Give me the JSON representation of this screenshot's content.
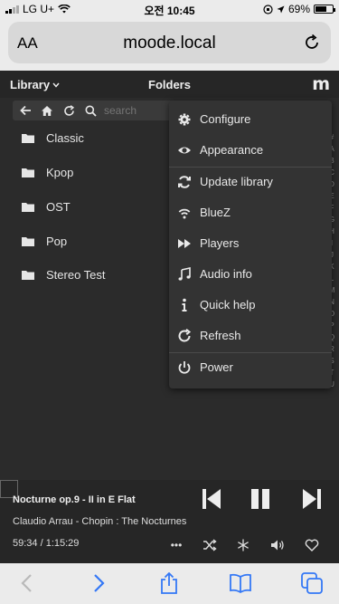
{
  "status_bar": {
    "carrier": "LG U+",
    "time": "오전 10:45",
    "battery": "69%"
  },
  "browser": {
    "aa_label": "AA",
    "url": "moode.local"
  },
  "app_header": {
    "library_label": "Library",
    "title": "Folders",
    "logo": "m"
  },
  "toolbar": {
    "search_placeholder": "search"
  },
  "folders": [
    {
      "label": "Classic"
    },
    {
      "label": "Kpop"
    },
    {
      "label": "OST"
    },
    {
      "label": "Pop"
    },
    {
      "label": "Stereo Test"
    }
  ],
  "alphabet_index": [
    "#",
    "A",
    "B",
    "C",
    "D",
    "E",
    "F",
    "G",
    "H",
    "I",
    "J",
    "K",
    "L",
    "M",
    "N",
    "O",
    "P",
    "Q",
    "R",
    "S",
    "T",
    "U"
  ],
  "menu": {
    "items": [
      {
        "label": "Configure",
        "icon": "gear-icon"
      },
      {
        "label": "Appearance",
        "icon": "eye-icon"
      },
      {
        "label": "Update library",
        "icon": "sync-icon"
      },
      {
        "label": "BlueZ",
        "icon": "wifi-icon"
      },
      {
        "label": "Players",
        "icon": "fast-forward-icon"
      },
      {
        "label": "Audio info",
        "icon": "music-note-icon"
      },
      {
        "label": "Quick help",
        "icon": "info-icon"
      },
      {
        "label": "Refresh",
        "icon": "refresh-icon"
      },
      {
        "label": "Power",
        "icon": "power-icon"
      }
    ]
  },
  "player": {
    "title": "Nocturne op.9 - II in E Flat",
    "artist": "Claudio Arrau - Chopin : The Nocturnes",
    "time": "59:34 / 1:15:29",
    "more_label": "•••"
  },
  "colors": {
    "background": "#2b2b2b",
    "menu_background": "#333333",
    "browser_chrome": "#ebebeb",
    "safari_blue": "#3478f6"
  }
}
